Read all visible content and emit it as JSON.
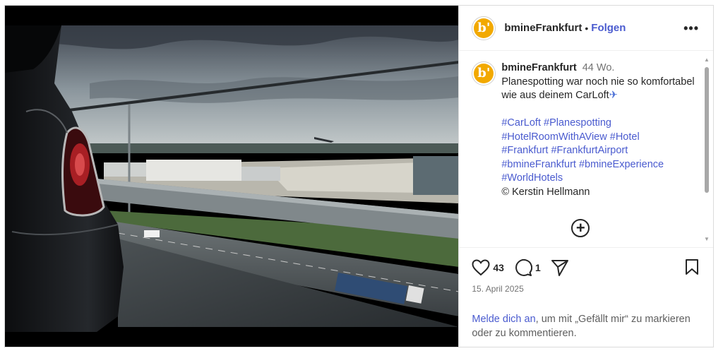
{
  "post": {
    "username": "bmineFrankfurt",
    "avatar_text": "b'",
    "follow_label": "Folgen",
    "separator": "•",
    "more_icon": "more-horizontal-icon",
    "more_label": "•••"
  },
  "caption": {
    "username": "bmineFrankfurt",
    "time": "44 Wo.",
    "text": "Planespotting war noch nie so komfortabel wie aus deinem CarLoft",
    "emoji": "✈",
    "hashtags": [
      "#CarLoft",
      "#Planespotting",
      "#HotelRoomWithAView",
      "#Hotel",
      "#Frankfurt",
      "#FrankfurtAirport",
      "#bmineFrankfurt",
      "#bmineExperience",
      "#WorldHotels"
    ],
    "credit": "© Kerstin Hellmann",
    "load_more_label": "+"
  },
  "actions": {
    "likes": "43",
    "comments": "1",
    "like_icon": "heart-icon",
    "comment_icon": "comment-icon",
    "share_icon": "share-icon",
    "save_icon": "bookmark-icon"
  },
  "date": "15. April 2025",
  "login_prompt": {
    "link": "Melde dich an",
    "rest": ", um mit „Gefällt mir“ zu markieren oder zu kommentieren."
  },
  "colors": {
    "link_blue": "#4a5bcf",
    "logo_orange": "#f2a900",
    "muted": "#737373"
  }
}
